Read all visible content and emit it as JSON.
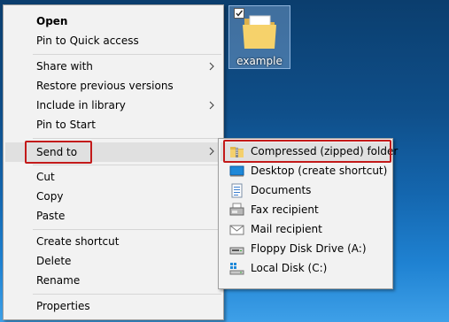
{
  "desktop": {
    "icon_label": "example"
  },
  "context_menu": {
    "items": [
      {
        "label": "Open"
      },
      {
        "label": "Pin to Quick access"
      },
      {
        "label": "Share with"
      },
      {
        "label": "Restore previous versions"
      },
      {
        "label": "Include in library"
      },
      {
        "label": "Pin to Start"
      },
      {
        "label": "Send to"
      },
      {
        "label": "Cut"
      },
      {
        "label": "Copy"
      },
      {
        "label": "Paste"
      },
      {
        "label": "Create shortcut"
      },
      {
        "label": "Delete"
      },
      {
        "label": "Rename"
      },
      {
        "label": "Properties"
      }
    ]
  },
  "send_to_menu": {
    "items": [
      {
        "label": "Compressed (zipped) folder",
        "icon": "zip-folder-icon"
      },
      {
        "label": "Desktop (create shortcut)",
        "icon": "desktop-icon"
      },
      {
        "label": "Documents",
        "icon": "documents-icon"
      },
      {
        "label": "Fax recipient",
        "icon": "fax-icon"
      },
      {
        "label": "Mail recipient",
        "icon": "mail-icon"
      },
      {
        "label": "Floppy Disk Drive (A:)",
        "icon": "floppy-disk-icon"
      },
      {
        "label": "Local Disk (C:)",
        "icon": "local-disk-icon"
      }
    ]
  },
  "colors": {
    "highlight_outline": "#c31a1a",
    "menu_bg": "#f2f2f2",
    "hover_bg": "#e0e0e0"
  }
}
